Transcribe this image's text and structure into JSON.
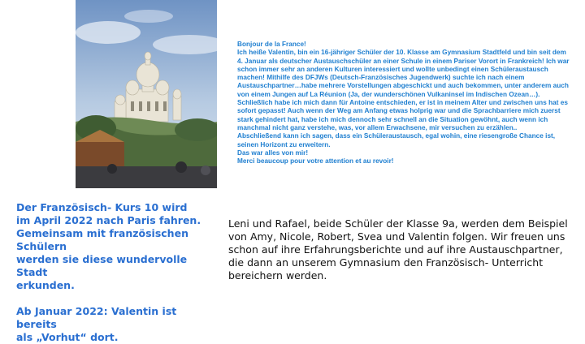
{
  "photo": {
    "subject": "Sacré-Cœur photo"
  },
  "letter": {
    "lines": [
      "Bonjour de la France!",
      "Ich heiße Valentin, bin ein 16-jähriger Schüler der 10. Klasse am Gymnasium Stadtfeld und bin seit dem 4. Januar als deutscher Austauschschüler an einer Schule in einem Pariser Vorort in Frankreich! Ich war schon immer sehr an anderen Kulturen interessiert und wollte unbedingt einen Schüleraustausch machen! Mithilfe des DFJWs (Deutsch-Französisches Jugendwerk) suchte ich nach einem Austauschpartner…habe mehrere Vorstellungen abgeschickt und auch bekommen, unter anderem auch von einem Jungen auf La Réunion (Ja, der wunderschönen Vulkaninsel im Indischen Ozean…). Schließlich habe ich mich dann für Antoine entschieden, er ist in meinem Alter und zwischen uns hat es sofort gepasst! Auch wenn der Weg am Anfang etwas holprig war und die Sprachbarriere mich zuerst stark gehindert hat, habe ich mich dennoch sehr schnell an die Situation gewöhnt, auch wenn ich manchmal nicht ganz verstehe, was, vor allem Erwachsene, mir versuchen zu erzählen..",
      "Abschließend kann ich sagen, dass ein Schüleraustausch, egal wohin, eine riesengroße Chance ist, seinen Horizont zu erweitern.",
      "Das war alles von mir!",
      "Merci beaucoup pour votre attention et au revoir!"
    ]
  },
  "note": {
    "paragraph1": "Der Französisch- Kurs 10 wird\nim April 2022 nach Paris fahren.\nGemeinsam mit französischen Schülern\nwerden sie diese wundervolle Stadt\nerkunden.",
    "paragraph2": "Ab Januar 2022: Valentin ist bereits\nals „Vorhut“ dort."
  },
  "followers": {
    "text": "Leni und Rafael, beide Schüler der Klasse 9a, werden dem Beispiel von Amy, Nicole, Robert, Svea und Valentin folgen. Wir freuen uns schon auf ihre Erfahrungsberichte und auf ihre Austauschpartner, die dann an unserem Gymnasium den Französisch- Unterricht bereichern werden."
  },
  "colors": {
    "accent_blue": "#1f7fd0",
    "note_blue": "#2a6fd1",
    "text": "#111111"
  }
}
